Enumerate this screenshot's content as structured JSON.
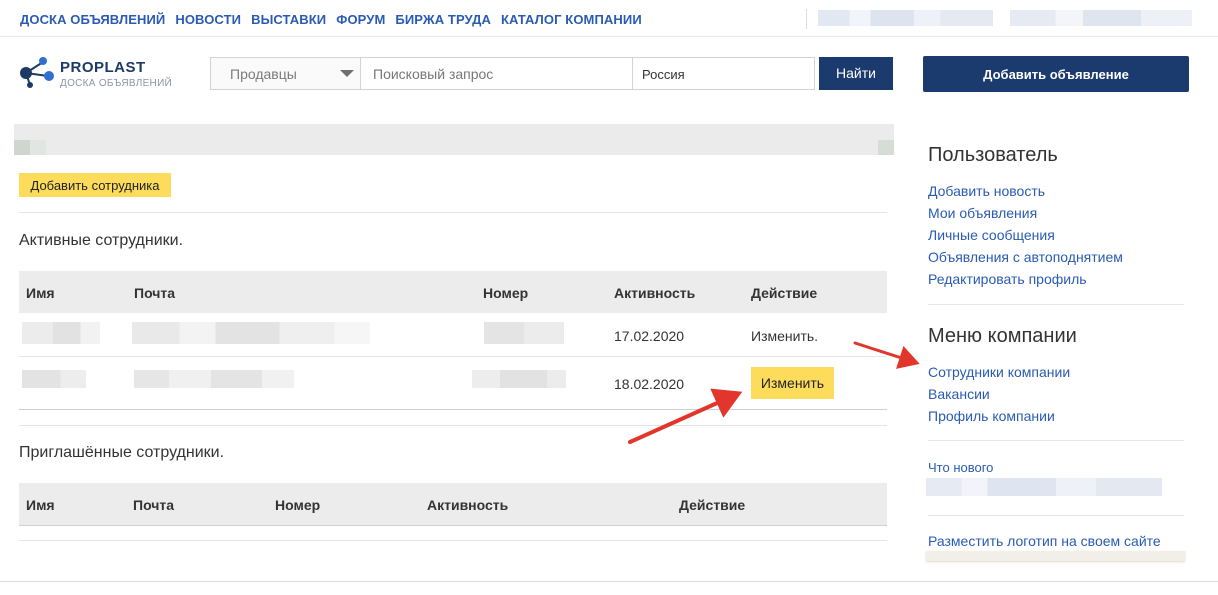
{
  "topnav": [
    "ДОСКА ОБЪЯВЛЕНИЙ",
    "НОВОСТИ",
    "ВЫСТАВКИ",
    "ФОРУМ",
    "БИРЖА ТРУДА",
    "КАТАЛОГ КОМПАНИИ"
  ],
  "logo": {
    "name": "PROPLAST",
    "subtitle": "ДОСКА ОБЪЯВЛЕНИЙ"
  },
  "search": {
    "category": "Продавцы",
    "query_placeholder": "Поисковый запрос",
    "region": "Россия",
    "submit": "Найти"
  },
  "add_ad_button": "Добавить объявление",
  "add_employee_button": "Добавить сотрудника",
  "active": {
    "title": "Активные сотрудники.",
    "columns": [
      "Имя",
      "Почта",
      "Номер",
      "Активность",
      "Действие"
    ],
    "rows": [
      {
        "date": "17.02.2020",
        "action": "Изменить."
      },
      {
        "date": "18.02.2020",
        "action": "Изменить"
      }
    ]
  },
  "invited": {
    "title": "Приглашённые сотрудники.",
    "columns": [
      "Имя",
      "Почта",
      "Номер",
      "Активность",
      "Действие"
    ]
  },
  "sidebar": {
    "user_title": "Пользователь",
    "user_links": [
      "Добавить новость",
      "Мои объявления",
      "Личные сообщения",
      "Объявления с автоподнятием",
      "Редактировать профиль"
    ],
    "company_title": "Меню компании",
    "company_links": [
      "Сотрудники компании",
      "Вакансии",
      "Профиль компании"
    ],
    "whats_new": "Что нового",
    "place_logo": "Разместить логотип на своем сайте"
  },
  "colors": {
    "brand": "#1b3a6e",
    "link": "#2a5bb3",
    "highlight": "#fddc5c",
    "arrow": "#e2352b"
  }
}
